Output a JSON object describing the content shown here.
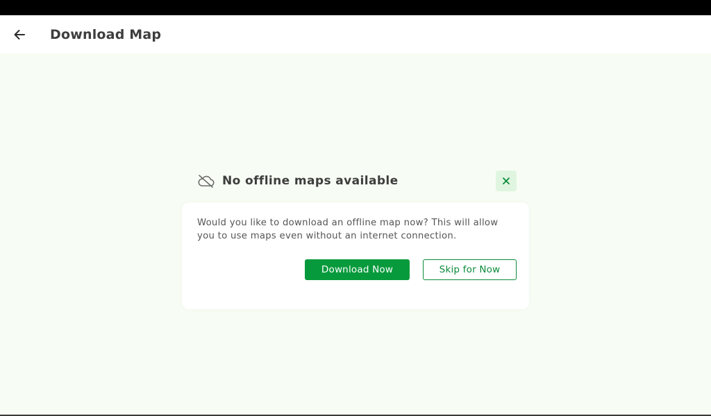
{
  "header": {
    "title": "Download Map",
    "back_icon": "arrow-left-icon"
  },
  "dialog": {
    "title": "No offline maps available",
    "title_icon": "cloud-off-icon",
    "close_icon": "close-icon",
    "message": "Would you like to download an offline map now? This will allow you to use maps even without an internet connection.",
    "primary_label": "Download Now",
    "secondary_label": "Skip for Now"
  },
  "colors": {
    "accent": "#079a3c",
    "background": "#f7fdf4",
    "close_bg": "#dff5df"
  }
}
